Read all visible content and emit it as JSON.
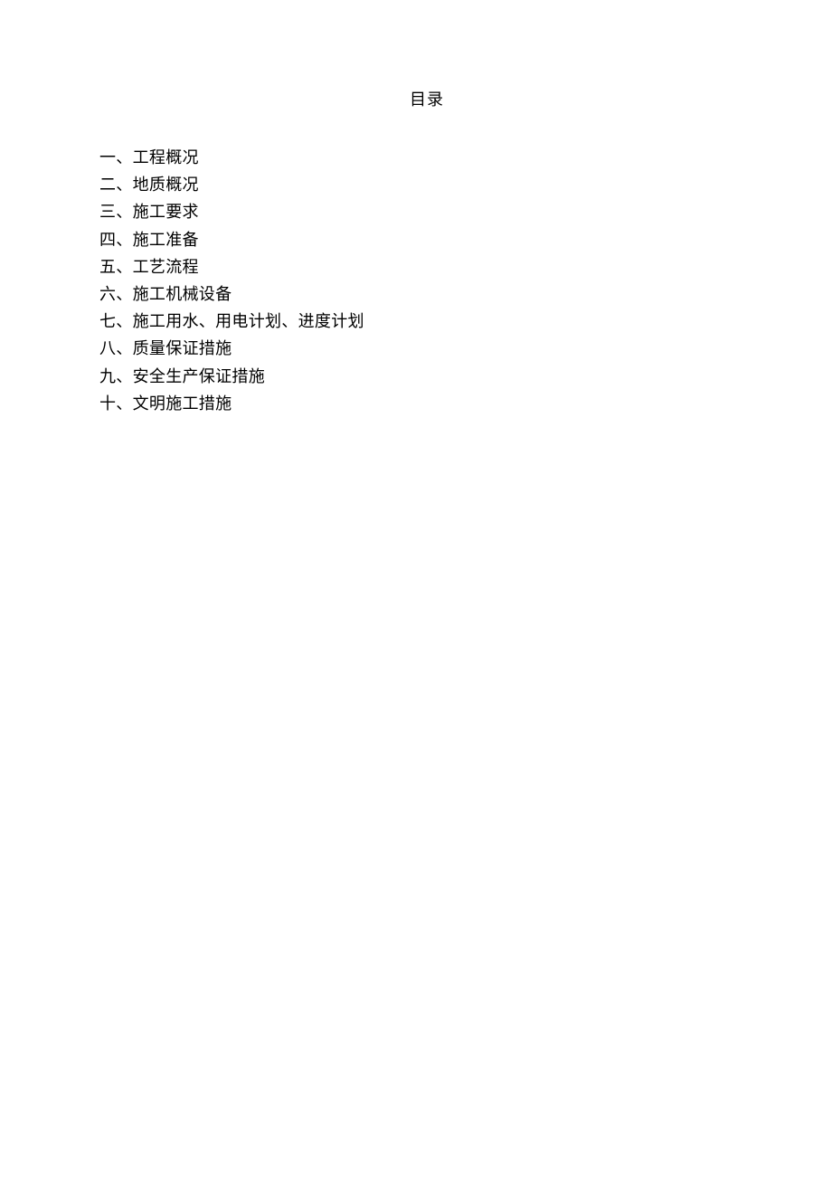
{
  "document": {
    "title": "目录",
    "toc": [
      {
        "label": "一、工程概况"
      },
      {
        "label": "二、地质概况"
      },
      {
        "label": "三、施工要求"
      },
      {
        "label": "四、施工准备"
      },
      {
        "label": "五、工艺流程"
      },
      {
        "label": "六、施工机械设备"
      },
      {
        "label": "七、施工用水、用电计划、进度计划"
      },
      {
        "label": "八、质量保证措施"
      },
      {
        "label": "九、安全生产保证措施"
      },
      {
        "label": "十、文明施工措施"
      }
    ]
  }
}
